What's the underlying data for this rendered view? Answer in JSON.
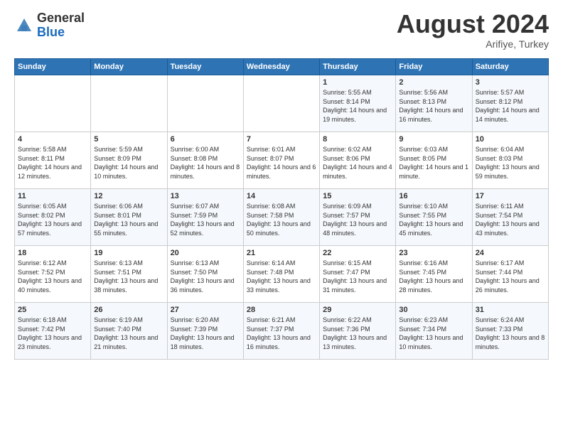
{
  "header": {
    "logo_general": "General",
    "logo_blue": "Blue",
    "month_title": "August 2024",
    "location": "Arifiye, Turkey"
  },
  "days_of_week": [
    "Sunday",
    "Monday",
    "Tuesday",
    "Wednesday",
    "Thursday",
    "Friday",
    "Saturday"
  ],
  "weeks": [
    [
      {
        "day": "",
        "sunrise": "",
        "sunset": "",
        "daylight": ""
      },
      {
        "day": "",
        "sunrise": "",
        "sunset": "",
        "daylight": ""
      },
      {
        "day": "",
        "sunrise": "",
        "sunset": "",
        "daylight": ""
      },
      {
        "day": "",
        "sunrise": "",
        "sunset": "",
        "daylight": ""
      },
      {
        "day": "1",
        "sunrise": "Sunrise: 5:55 AM",
        "sunset": "Sunset: 8:14 PM",
        "daylight": "Daylight: 14 hours and 19 minutes."
      },
      {
        "day": "2",
        "sunrise": "Sunrise: 5:56 AM",
        "sunset": "Sunset: 8:13 PM",
        "daylight": "Daylight: 14 hours and 16 minutes."
      },
      {
        "day": "3",
        "sunrise": "Sunrise: 5:57 AM",
        "sunset": "Sunset: 8:12 PM",
        "daylight": "Daylight: 14 hours and 14 minutes."
      }
    ],
    [
      {
        "day": "4",
        "sunrise": "Sunrise: 5:58 AM",
        "sunset": "Sunset: 8:11 PM",
        "daylight": "Daylight: 14 hours and 12 minutes."
      },
      {
        "day": "5",
        "sunrise": "Sunrise: 5:59 AM",
        "sunset": "Sunset: 8:09 PM",
        "daylight": "Daylight: 14 hours and 10 minutes."
      },
      {
        "day": "6",
        "sunrise": "Sunrise: 6:00 AM",
        "sunset": "Sunset: 8:08 PM",
        "daylight": "Daylight: 14 hours and 8 minutes."
      },
      {
        "day": "7",
        "sunrise": "Sunrise: 6:01 AM",
        "sunset": "Sunset: 8:07 PM",
        "daylight": "Daylight: 14 hours and 6 minutes."
      },
      {
        "day": "8",
        "sunrise": "Sunrise: 6:02 AM",
        "sunset": "Sunset: 8:06 PM",
        "daylight": "Daylight: 14 hours and 4 minutes."
      },
      {
        "day": "9",
        "sunrise": "Sunrise: 6:03 AM",
        "sunset": "Sunset: 8:05 PM",
        "daylight": "Daylight: 14 hours and 1 minute."
      },
      {
        "day": "10",
        "sunrise": "Sunrise: 6:04 AM",
        "sunset": "Sunset: 8:03 PM",
        "daylight": "Daylight: 13 hours and 59 minutes."
      }
    ],
    [
      {
        "day": "11",
        "sunrise": "Sunrise: 6:05 AM",
        "sunset": "Sunset: 8:02 PM",
        "daylight": "Daylight: 13 hours and 57 minutes."
      },
      {
        "day": "12",
        "sunrise": "Sunrise: 6:06 AM",
        "sunset": "Sunset: 8:01 PM",
        "daylight": "Daylight: 13 hours and 55 minutes."
      },
      {
        "day": "13",
        "sunrise": "Sunrise: 6:07 AM",
        "sunset": "Sunset: 7:59 PM",
        "daylight": "Daylight: 13 hours and 52 minutes."
      },
      {
        "day": "14",
        "sunrise": "Sunrise: 6:08 AM",
        "sunset": "Sunset: 7:58 PM",
        "daylight": "Daylight: 13 hours and 50 minutes."
      },
      {
        "day": "15",
        "sunrise": "Sunrise: 6:09 AM",
        "sunset": "Sunset: 7:57 PM",
        "daylight": "Daylight: 13 hours and 48 minutes."
      },
      {
        "day": "16",
        "sunrise": "Sunrise: 6:10 AM",
        "sunset": "Sunset: 7:55 PM",
        "daylight": "Daylight: 13 hours and 45 minutes."
      },
      {
        "day": "17",
        "sunrise": "Sunrise: 6:11 AM",
        "sunset": "Sunset: 7:54 PM",
        "daylight": "Daylight: 13 hours and 43 minutes."
      }
    ],
    [
      {
        "day": "18",
        "sunrise": "Sunrise: 6:12 AM",
        "sunset": "Sunset: 7:52 PM",
        "daylight": "Daylight: 13 hours and 40 minutes."
      },
      {
        "day": "19",
        "sunrise": "Sunrise: 6:13 AM",
        "sunset": "Sunset: 7:51 PM",
        "daylight": "Daylight: 13 hours and 38 minutes."
      },
      {
        "day": "20",
        "sunrise": "Sunrise: 6:13 AM",
        "sunset": "Sunset: 7:50 PM",
        "daylight": "Daylight: 13 hours and 36 minutes."
      },
      {
        "day": "21",
        "sunrise": "Sunrise: 6:14 AM",
        "sunset": "Sunset: 7:48 PM",
        "daylight": "Daylight: 13 hours and 33 minutes."
      },
      {
        "day": "22",
        "sunrise": "Sunrise: 6:15 AM",
        "sunset": "Sunset: 7:47 PM",
        "daylight": "Daylight: 13 hours and 31 minutes."
      },
      {
        "day": "23",
        "sunrise": "Sunrise: 6:16 AM",
        "sunset": "Sunset: 7:45 PM",
        "daylight": "Daylight: 13 hours and 28 minutes."
      },
      {
        "day": "24",
        "sunrise": "Sunrise: 6:17 AM",
        "sunset": "Sunset: 7:44 PM",
        "daylight": "Daylight: 13 hours and 26 minutes."
      }
    ],
    [
      {
        "day": "25",
        "sunrise": "Sunrise: 6:18 AM",
        "sunset": "Sunset: 7:42 PM",
        "daylight": "Daylight: 13 hours and 23 minutes."
      },
      {
        "day": "26",
        "sunrise": "Sunrise: 6:19 AM",
        "sunset": "Sunset: 7:40 PM",
        "daylight": "Daylight: 13 hours and 21 minutes."
      },
      {
        "day": "27",
        "sunrise": "Sunrise: 6:20 AM",
        "sunset": "Sunset: 7:39 PM",
        "daylight": "Daylight: 13 hours and 18 minutes."
      },
      {
        "day": "28",
        "sunrise": "Sunrise: 6:21 AM",
        "sunset": "Sunset: 7:37 PM",
        "daylight": "Daylight: 13 hours and 16 minutes."
      },
      {
        "day": "29",
        "sunrise": "Sunrise: 6:22 AM",
        "sunset": "Sunset: 7:36 PM",
        "daylight": "Daylight: 13 hours and 13 minutes."
      },
      {
        "day": "30",
        "sunrise": "Sunrise: 6:23 AM",
        "sunset": "Sunset: 7:34 PM",
        "daylight": "Daylight: 13 hours and 10 minutes."
      },
      {
        "day": "31",
        "sunrise": "Sunrise: 6:24 AM",
        "sunset": "Sunset: 7:33 PM",
        "daylight": "Daylight: 13 hours and 8 minutes."
      }
    ]
  ]
}
